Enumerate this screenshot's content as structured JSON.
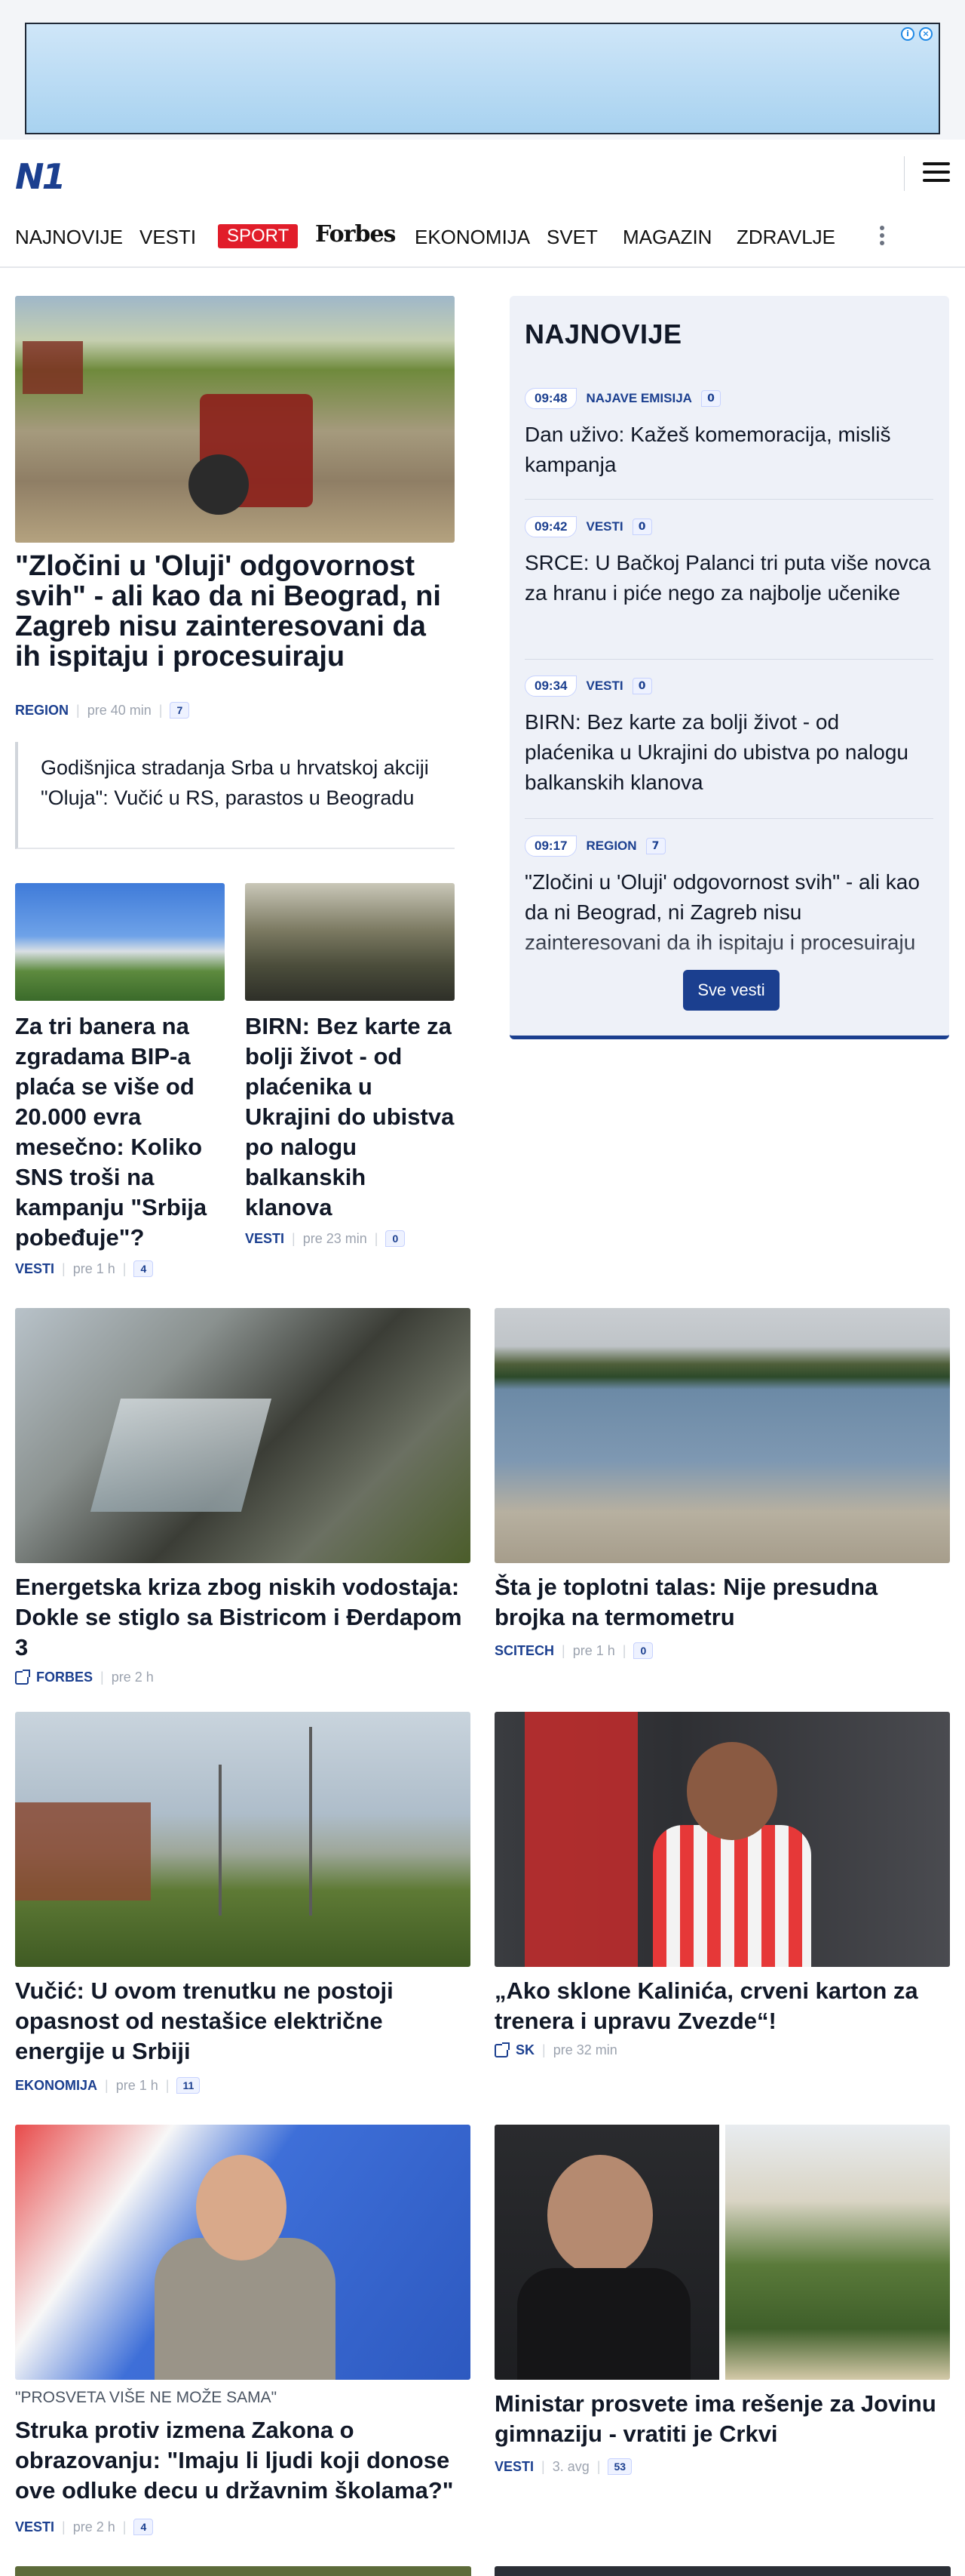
{
  "ad": {
    "info_icon": "info-icon",
    "close_icon": "close-icon"
  },
  "header": {
    "logo": "N1",
    "menu_icon": "hamburger-icon"
  },
  "nav": {
    "items": [
      "NAJNOVIJE",
      "VESTI",
      "SPORT",
      "Forbes",
      "EKONOMIJA",
      "SVET",
      "MAGAZIN",
      "ZDRAVLJE"
    ],
    "more_icon": "more-vertical-icon"
  },
  "lead": {
    "title": "\"Zločini u 'Oluji' odgovornost svih\" - ali kao da ni Beograd, ni Zagreb nisu zainteresovani da ih ispitaju i procesuiraju",
    "category": "REGION",
    "time": "pre 40 min",
    "comments": "7",
    "related": "Godišnjica stradanja Srba u hrvatskoj akciji \"Oluja\": Vučić u RS, parastos u Beogradu"
  },
  "small_cards": [
    {
      "title": "Za tri banera na zgradama BIP-a plaća se više od 20.000 evra mesečno: Koliko SNS troši na kampanju \"Srbija pobeđuje\"?",
      "category": "VESTI",
      "time": "pre 1 h",
      "comments": "4"
    },
    {
      "title": "BIRN: Bez karte za bolji život - od plaćenika u Ukrajini do ubistva po nalogu balkanskih klanova",
      "category": "VESTI",
      "time": "pre 23 min",
      "comments": "0"
    }
  ],
  "latest": {
    "heading": "NAJNOVIJE",
    "items": [
      {
        "time": "09:48",
        "category": "NAJAVE EMISIJA",
        "comments": "0",
        "title": "Dan uživo: Kažeš komemoracija, misliš kampanja"
      },
      {
        "time": "09:42",
        "category": "VESTI",
        "comments": "0",
        "title": "SRCE: U Bačkoj Palanci tri puta više novca za hranu i piće nego za najbolje učenike"
      },
      {
        "time": "09:34",
        "category": "VESTI",
        "comments": "0",
        "title": "BIRN: Bez karte za bolji život - od plaćenika u Ukrajini do ubistva po nalogu balkanskih klanova"
      },
      {
        "time": "09:17",
        "category": "REGION",
        "comments": "7",
        "title": "\"Zločini u 'Oluji' odgovornost svih\" - ali kao da ni Beograd, ni Zagreb nisu zainteresovani da ih ispitaju i procesuiraju"
      }
    ],
    "all_button": "Sve vesti"
  },
  "grid": [
    {
      "title": "Energetska kriza zbog niskih vodostaja: Dokle se stiglo sa Bistricom i Đerdapom 3",
      "category": "FORBES",
      "external": true,
      "time": "pre 2 h"
    },
    {
      "title": "Šta je toplotni talas: Nije presudna brojka na termometru",
      "category": "SCITECH",
      "time": "pre 1 h",
      "comments": "0"
    },
    {
      "title": "Vučić: U ovom trenutku ne postoji opasnost od nestašice električne energije u Srbiji",
      "category": "EKONOMIJA",
      "time": "pre 1 h",
      "comments": "11"
    },
    {
      "title": "„Ako sklone Kalinića, crveni karton za trenera i upravu Zvezde“!",
      "category": "SK",
      "external": true,
      "time": "pre 32 min"
    },
    {
      "tag": "\"PROSVETA VIŠE NE MOŽE SAMA\"",
      "title": "Struka protiv izmena Zakona o obrazovanju: \"Imaju li ljudi koji donose ove odluke decu u državnim školama?\"",
      "category": "VESTI",
      "time": "pre 2 h",
      "comments": "4"
    },
    {
      "title": "Ministar prosvete ima rešenje za Jovinu gimnaziju - vratiti je Crkvi",
      "category": "VESTI",
      "time": "3. avg",
      "comments": "53"
    }
  ]
}
